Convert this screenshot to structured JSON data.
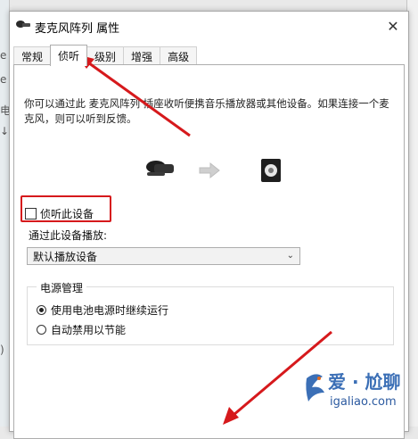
{
  "window": {
    "title": "麦克风阵列 属性",
    "close_glyph": "✕"
  },
  "tabs": [
    {
      "label": "常规",
      "active": false
    },
    {
      "label": "侦听",
      "active": true
    },
    {
      "label": "级别",
      "active": false
    },
    {
      "label": "增强",
      "active": false
    },
    {
      "label": "高级",
      "active": false
    }
  ],
  "listen": {
    "description": "你可以通过此 麦克风阵列 插座收听便携音乐播放器或其他设备。如果连接一个麦克风，则可以听到反馈。",
    "checkbox_label": "侦听此设备",
    "checkbox_checked": false,
    "playback_label": "通过此设备播放:",
    "playback_value": "默认播放设备"
  },
  "power": {
    "legend": "电源管理",
    "options": [
      {
        "label": "使用电池电源时继续运行",
        "selected": true
      },
      {
        "label": "自动禁用以节能",
        "selected": false
      }
    ]
  },
  "background": {
    "left_fragments": [
      "e",
      "e",
      "电",
      "↓",
      ")"
    ]
  },
  "watermark": {
    "title": "爱 · 尬聊",
    "url": "igaliao.com"
  },
  "colors": {
    "annotation_red": "#d6191c",
    "watermark_blue": "#3b6fb6"
  }
}
